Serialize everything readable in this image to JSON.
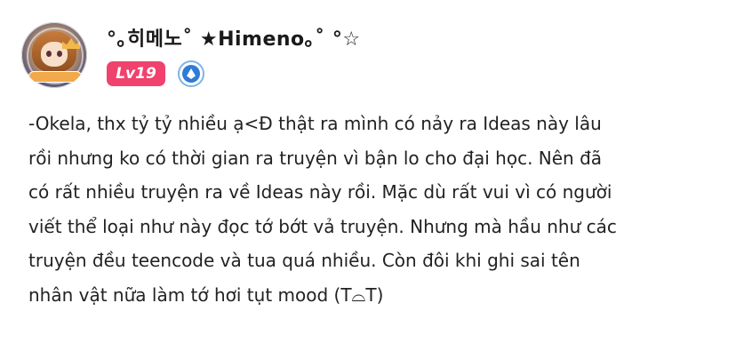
{
  "user": {
    "name": "°｡히메노˚ ★Himeno｡˚ °☆",
    "level_label": "Lv19",
    "badge_icon": "blue-diamond-badge-icon"
  },
  "message": {
    "lines": [
      "-Okela, thx tỷ tỷ nhiều ạ<Đ thật ra mình có nảy ra Ideas này lâu",
      "rồi nhưng ko có thời gian ra truyện vì bận lo cho đại học. Nên đã",
      "có rất nhiều truyện ra về Ideas này rồi. Mặc dù rất vui vì có người",
      "viết thể loại như này đọc tớ bớt vả truyện. Nhưng mà hầu như các",
      "truyện đều teencode và tua quá nhiều. Còn đôi khi ghi sai tên",
      "nhân vật nữa làm tớ hơi tụt mood (T⌓T)"
    ]
  },
  "colors": {
    "level_badge": "#f0426d",
    "verified_badge": "#2f7bd6",
    "text": "#222222"
  }
}
